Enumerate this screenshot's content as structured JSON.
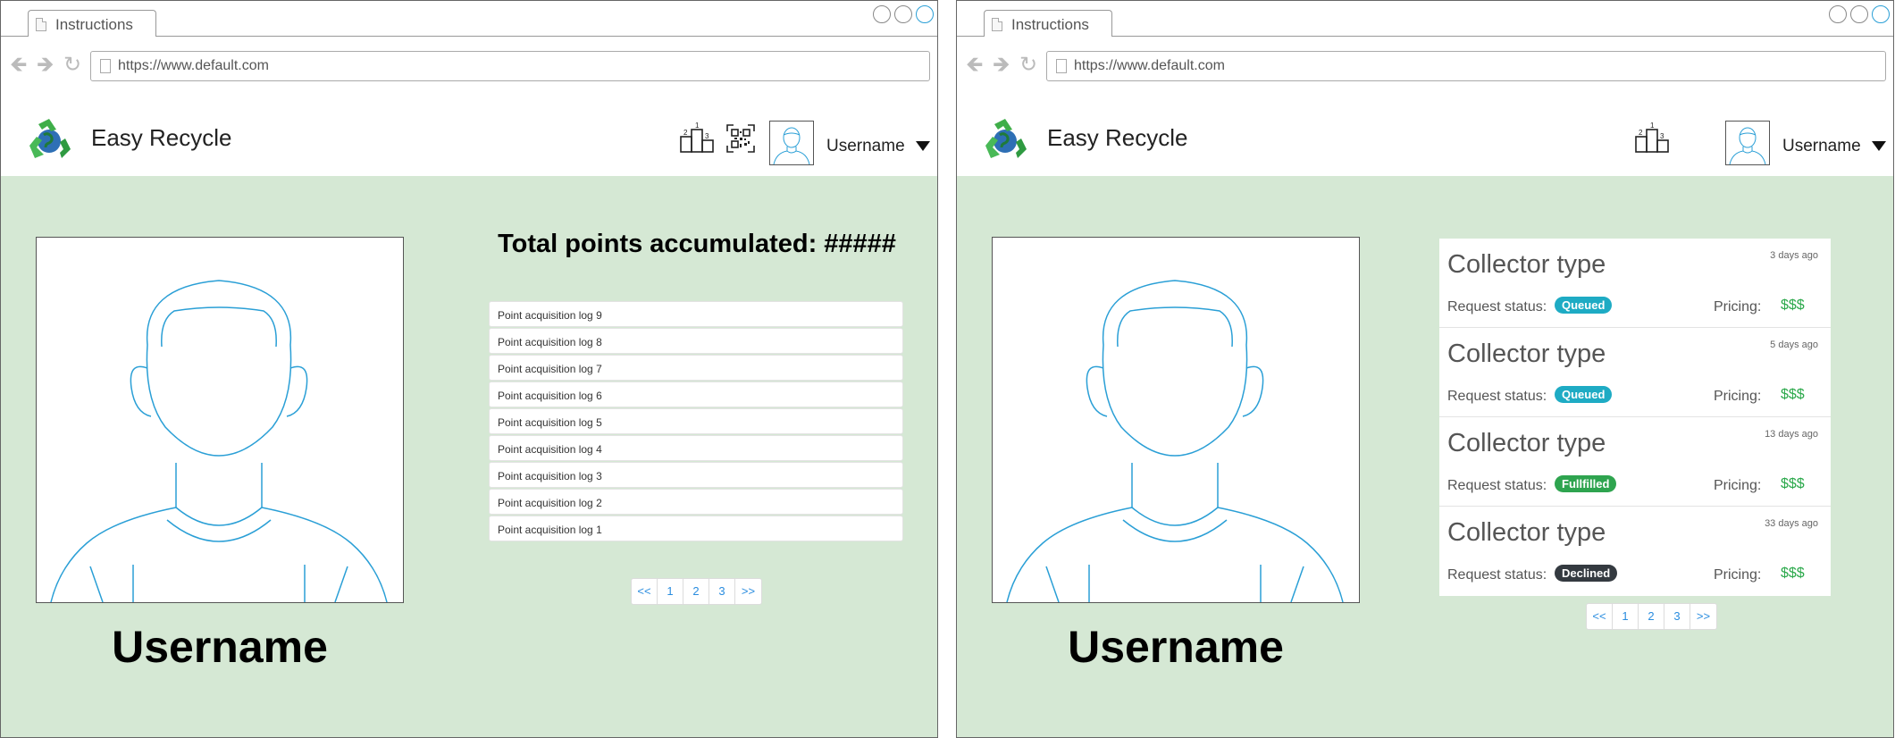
{
  "colors": {
    "content_bg": "#d5e8d4",
    "link_blue": "#2a8ddf",
    "badge_queued": "#1eabc4",
    "badge_fulfilled": "#2ea44f",
    "badge_declined": "#343a40",
    "price_green": "#2aa84a",
    "icon_blue": "#2a9fd6"
  },
  "left": {
    "browser": {
      "tab_label": "Instructions",
      "url": "https://www.default.com"
    },
    "appbar": {
      "title": "Easy Recycle",
      "username": "Username",
      "icons": [
        "recycle-logo",
        "leaderboard-icon",
        "qr-code-icon",
        "avatar",
        "caret-down-icon"
      ]
    },
    "profile": {
      "name": "Username"
    },
    "points": {
      "title": "Total points accumulated: #####",
      "logs": [
        "Point acquisition log 9",
        "Point acquisition log 8",
        "Point acquisition log 7",
        "Point acquisition log 6",
        "Point acquisition log 5",
        "Point acquisition log 4",
        "Point acquisition log 3",
        "Point acquisition log 2",
        "Point acquisition log 1"
      ]
    },
    "pager": [
      "<<",
      "1",
      "2",
      "3",
      ">>"
    ]
  },
  "right": {
    "browser": {
      "tab_label": "Instructions",
      "url": "https://www.default.com"
    },
    "appbar": {
      "title": "Easy Recycle",
      "username": "Username",
      "icons": [
        "recycle-logo",
        "leaderboard-icon",
        "avatar",
        "caret-down-icon"
      ]
    },
    "profile": {
      "name": "Username"
    },
    "requests": [
      {
        "title": "Collector type",
        "time": "3 days ago",
        "status_label": "Request status:",
        "status": "Queued",
        "status_color": "#1eabc4",
        "pricing_label": "Pricing:",
        "price": "$$$"
      },
      {
        "title": "Collector type",
        "time": "5 days ago",
        "status_label": "Request status:",
        "status": "Queued",
        "status_color": "#1eabc4",
        "pricing_label": "Pricing:",
        "price": "$$$"
      },
      {
        "title": "Collector type",
        "time": "13 days ago",
        "status_label": "Request status:",
        "status": "Fullfilled",
        "status_color": "#2ea44f",
        "pricing_label": "Pricing:",
        "price": "$$$"
      },
      {
        "title": "Collector type",
        "time": "33 days ago",
        "status_label": "Request status:",
        "status": "Declined",
        "status_color": "#343a40",
        "pricing_label": "Pricing:",
        "price": "$$$"
      }
    ],
    "pager": [
      "<<",
      "1",
      "2",
      "3",
      ">>"
    ]
  }
}
